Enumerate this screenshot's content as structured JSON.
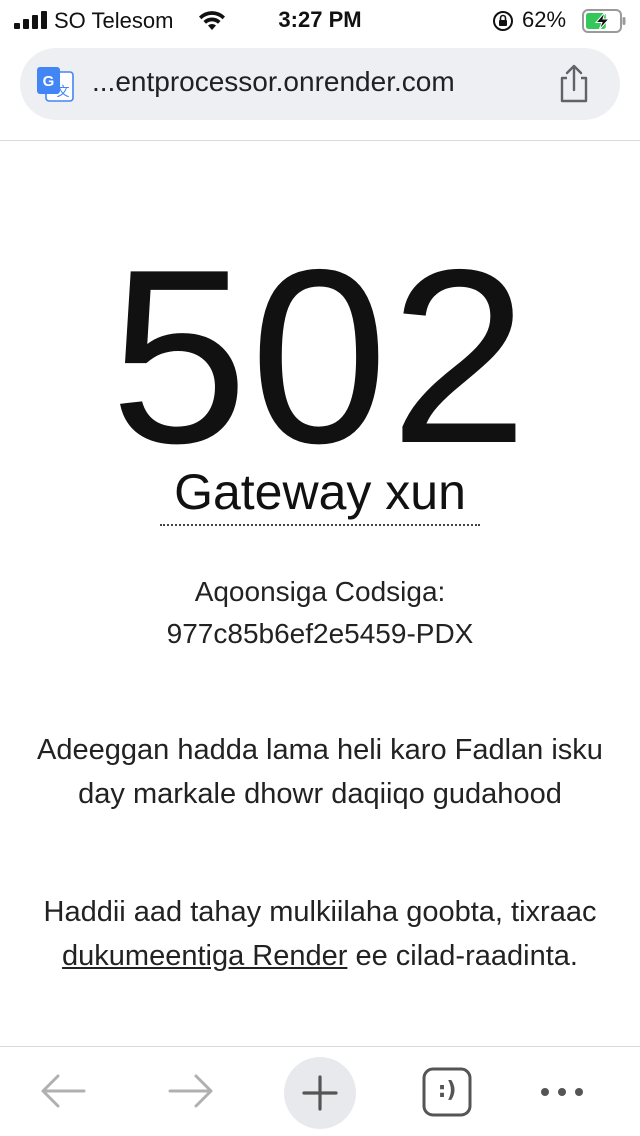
{
  "status_bar": {
    "carrier": "SO Telesom",
    "time": "3:27 PM",
    "battery_percent": "62%",
    "signal_bars": 4,
    "battery_level": 0.62,
    "charging": true
  },
  "url_bar": {
    "url": "...entprocessor.onrender.com",
    "translate_icon": "translate-icon",
    "share_icon": "share-icon"
  },
  "error": {
    "code": "502",
    "title": "Gateway xun",
    "request_id_label": "Aqoonsiga Codsiga:",
    "request_id": "977c85b6ef2e5459-PDX",
    "unavailable_message": "Adeeggan hadda lama heli karo Fadlan isku day markale dhowr daqiiqo gudahood",
    "owner_prefix": "Haddii aad tahay mulkiilaha goobta, tixraac ",
    "owner_link": "dukumeentiga Render",
    "owner_suffix": " ee cilad-raadinta."
  },
  "toolbar": {
    "tabs_icon_text": ":)",
    "icons": [
      "back-arrow-icon",
      "forward-arrow-icon",
      "plus-icon",
      "tabs-icon",
      "more-dots-icon"
    ]
  },
  "colors": {
    "url_bar_bg": "#eeeff2",
    "battery_green": "#34c759",
    "translate_blue": "#4285f4",
    "toolbar_inactive": "#b0b0b0",
    "toolbar_active": "#555555"
  }
}
